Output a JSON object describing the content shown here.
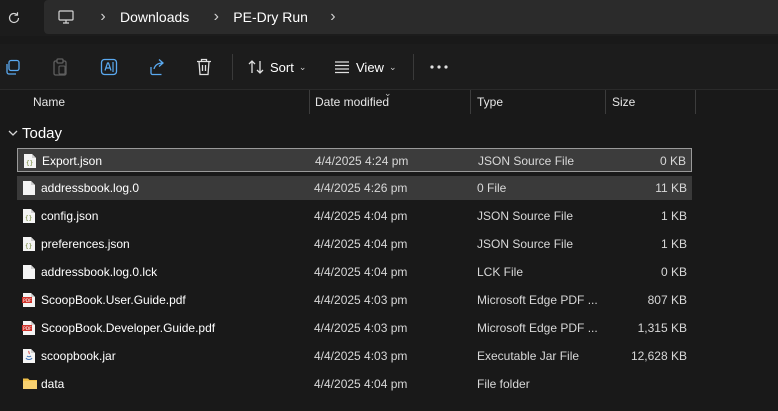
{
  "address": {
    "breadcrumbs": [
      "Downloads",
      "PE-Dry Run"
    ]
  },
  "toolbar": {
    "sort_label": "Sort",
    "view_label": "View"
  },
  "columns": {
    "name": "Name",
    "date": "Date modified",
    "type": "Type",
    "size": "Size"
  },
  "group": {
    "title": "Today"
  },
  "files": [
    {
      "name": "Export.json",
      "date": "4/4/2025 4:24 pm",
      "type": "JSON Source File",
      "size": "0 KB",
      "icon": "json-file-icon",
      "state": "selected"
    },
    {
      "name": "addressbook.log.0",
      "date": "4/4/2025 4:26 pm",
      "type": "0 File",
      "size": "11 KB",
      "icon": "generic-file-icon",
      "state": "hover"
    },
    {
      "name": "config.json",
      "date": "4/4/2025 4:04 pm",
      "type": "JSON Source File",
      "size": "1 KB",
      "icon": "json-file-icon",
      "state": ""
    },
    {
      "name": "preferences.json",
      "date": "4/4/2025 4:04 pm",
      "type": "JSON Source File",
      "size": "1 KB",
      "icon": "json-file-icon",
      "state": ""
    },
    {
      "name": "addressbook.log.0.lck",
      "date": "4/4/2025 4:04 pm",
      "type": "LCK File",
      "size": "0 KB",
      "icon": "generic-file-icon",
      "state": ""
    },
    {
      "name": "ScoopBook.User.Guide.pdf",
      "date": "4/4/2025 4:03 pm",
      "type": "Microsoft Edge PDF ...",
      "size": "807 KB",
      "icon": "pdf-file-icon",
      "state": ""
    },
    {
      "name": "ScoopBook.Developer.Guide.pdf",
      "date": "4/4/2025 4:03 pm",
      "type": "Microsoft Edge PDF ...",
      "size": "1,315 KB",
      "icon": "pdf-file-icon",
      "state": ""
    },
    {
      "name": "scoopbook.jar",
      "date": "4/4/2025 4:03 pm",
      "type": "Executable Jar File",
      "size": "12,628 KB",
      "icon": "jar-file-icon",
      "state": ""
    },
    {
      "name": "data",
      "date": "4/4/2025 4:04 pm",
      "type": "File folder",
      "size": "",
      "icon": "folder-icon",
      "state": ""
    }
  ]
}
